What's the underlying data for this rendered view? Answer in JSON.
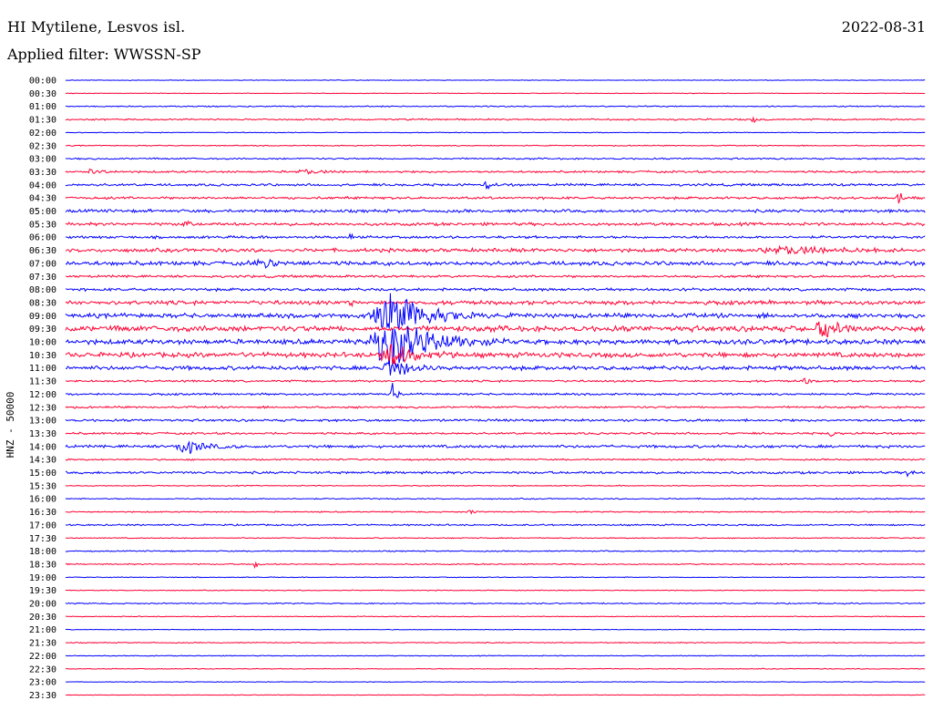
{
  "header": {
    "station": "HI Mytilene, Lesvos isl.",
    "date": "2022-08-31",
    "filter": "Applied filter: WWSSN-SP"
  },
  "chart_data": {
    "type": "line",
    "ylabel": "HNZ - 50000",
    "colors": {
      "even": "#0000ff",
      "odd": "#ff0033"
    },
    "rows": [
      "00:00",
      "00:30",
      "01:00",
      "01:30",
      "02:00",
      "02:30",
      "03:00",
      "03:30",
      "04:00",
      "04:30",
      "05:00",
      "05:30",
      "06:00",
      "06:30",
      "07:00",
      "07:30",
      "08:00",
      "08:30",
      "09:00",
      "09:30",
      "10:00",
      "10:30",
      "11:00",
      "11:30",
      "12:00",
      "12:30",
      "13:00",
      "13:30",
      "14:00",
      "14:30",
      "15:00",
      "15:30",
      "16:00",
      "16:30",
      "17:00",
      "17:30",
      "18:00",
      "18:30",
      "19:00",
      "19:30",
      "20:00",
      "20:30",
      "21:00",
      "21:30",
      "22:00",
      "22:30",
      "23:00",
      "23:30"
    ],
    "noise": [
      0.3,
      0.3,
      0.6,
      0.8,
      0.4,
      0.5,
      0.8,
      1.0,
      1.2,
      1.2,
      1.5,
      1.5,
      1.3,
      1.8,
      2.0,
      1.2,
      1.4,
      2.0,
      2.2,
      2.8,
      2.5,
      2.4,
      2.0,
      1.0,
      1.0,
      1.0,
      1.2,
      1.0,
      1.4,
      0.8,
      1.2,
      0.5,
      0.6,
      0.6,
      0.8,
      0.5,
      0.6,
      0.6,
      0.4,
      0.4,
      0.6,
      0.4,
      0.3,
      0.5,
      0.4,
      0.4,
      0.3,
      0.3
    ],
    "events": [
      {
        "row": 3,
        "pos": 0.8,
        "amp": 4,
        "width": 0.004
      },
      {
        "row": 7,
        "pos": 0.03,
        "amp": 3,
        "width": 0.012
      },
      {
        "row": 7,
        "pos": 0.28,
        "amp": 3,
        "width": 0.015
      },
      {
        "row": 8,
        "pos": 0.49,
        "amp": 6,
        "width": 0.004
      },
      {
        "row": 9,
        "pos": 0.97,
        "amp": 8,
        "width": 0.006
      },
      {
        "row": 11,
        "pos": 0.14,
        "amp": 5,
        "width": 0.004
      },
      {
        "row": 12,
        "pos": 0.33,
        "amp": 4,
        "width": 0.003
      },
      {
        "row": 13,
        "pos": 0.84,
        "amp": 5,
        "width": 0.04
      },
      {
        "row": 14,
        "pos": 0.23,
        "amp": 4,
        "width": 0.02
      },
      {
        "row": 17,
        "pos": 0.33,
        "amp": 5,
        "width": 0.004
      },
      {
        "row": 18,
        "pos": 0.38,
        "amp": 30,
        "width": 0.03
      },
      {
        "row": 19,
        "pos": 0.88,
        "amp": 12,
        "width": 0.014
      },
      {
        "row": 20,
        "pos": 0.38,
        "amp": 36,
        "width": 0.035
      },
      {
        "row": 21,
        "pos": 0.38,
        "amp": 14,
        "width": 0.02
      },
      {
        "row": 22,
        "pos": 0.38,
        "amp": 16,
        "width": 0.015
      },
      {
        "row": 23,
        "pos": 0.86,
        "amp": 5,
        "width": 0.004
      },
      {
        "row": 24,
        "pos": 0.38,
        "amp": 14,
        "width": 0.004
      },
      {
        "row": 27,
        "pos": 0.89,
        "amp": 5,
        "width": 0.004
      },
      {
        "row": 28,
        "pos": 0.14,
        "amp": 10,
        "width": 0.016
      },
      {
        "row": 30,
        "pos": 0.98,
        "amp": 4,
        "width": 0.004
      },
      {
        "row": 33,
        "pos": 0.47,
        "amp": 4,
        "width": 0.004
      },
      {
        "row": 37,
        "pos": 0.22,
        "amp": 5,
        "width": 0.003
      }
    ]
  }
}
